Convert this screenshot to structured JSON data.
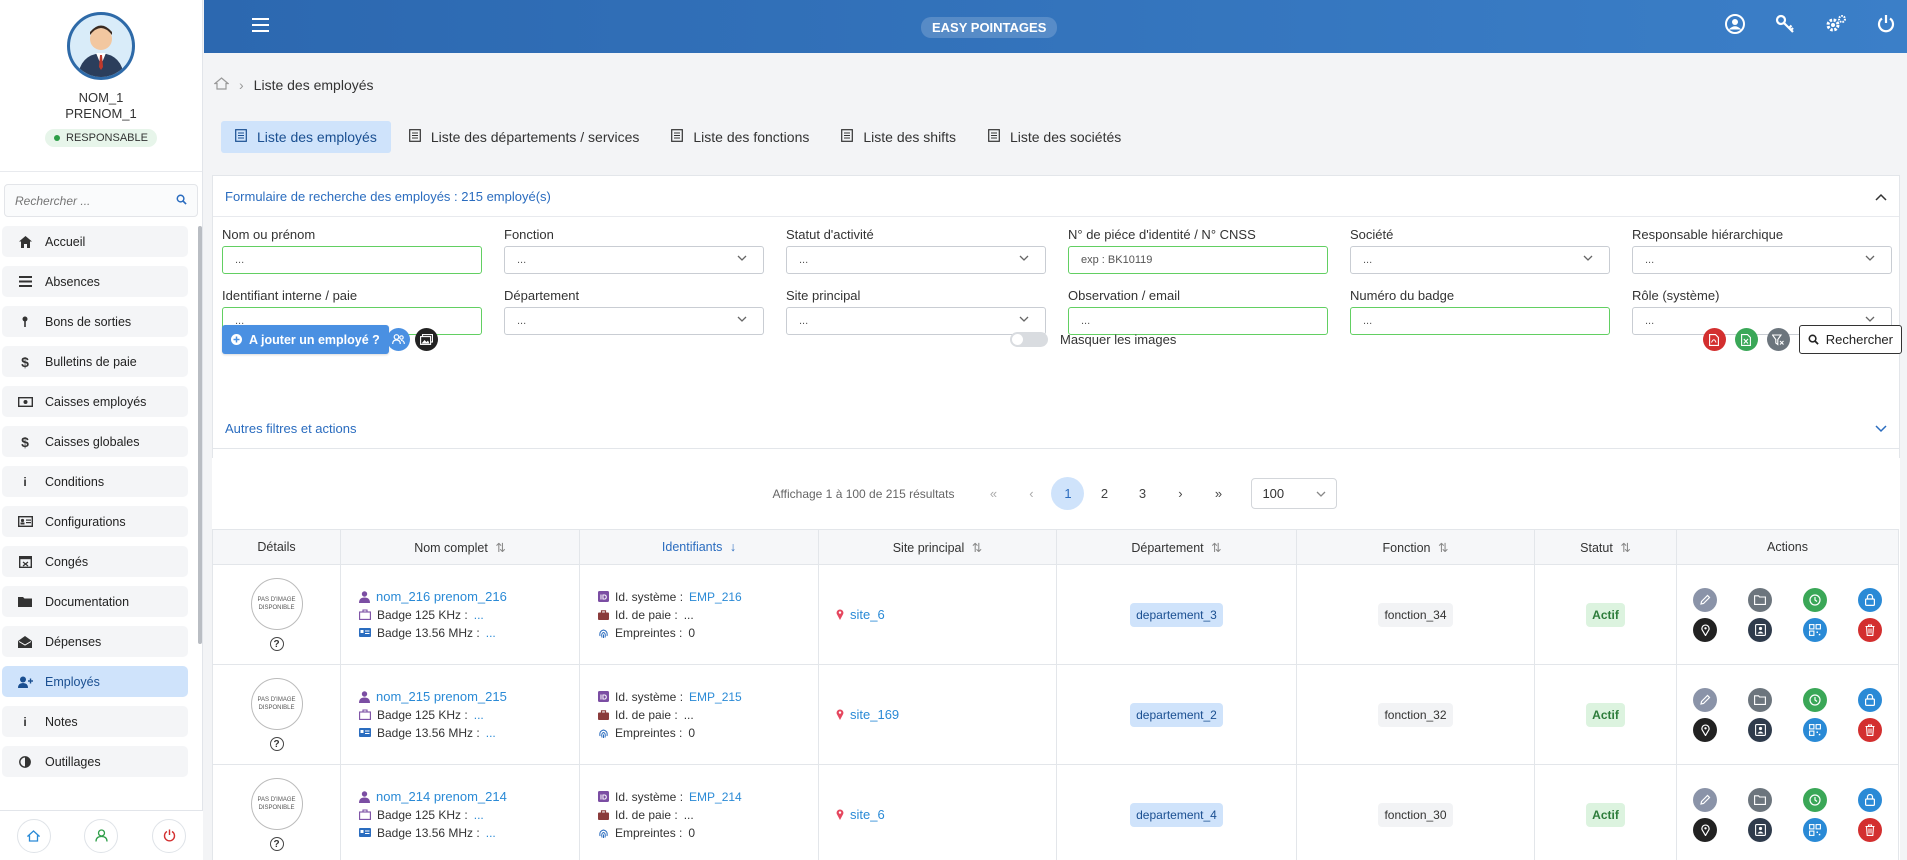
{
  "profile": {
    "last_name": "NOM_1",
    "first_name": "PRENOM_1",
    "role": "RESPONSABLE"
  },
  "sidebar": {
    "search_placeholder": "Rechercher ...",
    "items": [
      {
        "label": "Accueil",
        "icon": "home-icon"
      },
      {
        "label": "Absences",
        "icon": "list-icon"
      },
      {
        "label": "Bons de sorties",
        "icon": "key-icon"
      },
      {
        "label": "Bulletins de paie",
        "icon": "dollar-icon"
      },
      {
        "label": "Caisses employés",
        "icon": "cash-icon"
      },
      {
        "label": "Caisses globales",
        "icon": "dollar-icon"
      },
      {
        "label": "Conditions",
        "icon": "info-icon"
      },
      {
        "label": "Configurations",
        "icon": "id-card-icon"
      },
      {
        "label": "Congés",
        "icon": "calendar-icon"
      },
      {
        "label": "Documentation",
        "icon": "folder-icon"
      },
      {
        "label": "Dépenses",
        "icon": "envelope-icon"
      },
      {
        "label": "Employés",
        "icon": "user-plus-icon",
        "active": true
      },
      {
        "label": "Notes",
        "icon": "info-icon"
      },
      {
        "label": "Outillages",
        "icon": "contrast-icon"
      }
    ]
  },
  "topbar": {
    "brand": "EASY POINTAGES"
  },
  "breadcrumb": {
    "current": "Liste des employés"
  },
  "tabs": [
    {
      "label": "Liste des employés",
      "active": true
    },
    {
      "label": "Liste des départements / services"
    },
    {
      "label": "Liste des fonctions"
    },
    {
      "label": "Liste des shifts"
    },
    {
      "label": "Liste des sociétés"
    }
  ],
  "search_form": {
    "title": "Formulaire de recherche des employés : 215 employé(s)",
    "fields": [
      {
        "label": "Nom ou prénom",
        "value": "...",
        "type": "input"
      },
      {
        "label": "Fonction",
        "value": "...",
        "type": "select"
      },
      {
        "label": "Statut d'activité",
        "value": "...",
        "type": "select"
      },
      {
        "label": "N° de piéce d'identité / N° CNSS",
        "value": "exp : BK10119",
        "type": "input"
      },
      {
        "label": "Société",
        "value": "...",
        "type": "select"
      },
      {
        "label": "Responsable hiérarchique",
        "value": "...",
        "type": "select"
      },
      {
        "label": "Identifiant interne / paie",
        "value": "...",
        "type": "input"
      },
      {
        "label": "Département",
        "value": "...",
        "type": "select"
      },
      {
        "label": "Site principal",
        "value": "...",
        "type": "select"
      },
      {
        "label": "Observation / email",
        "value": "...",
        "type": "input"
      },
      {
        "label": "Numéro du badge",
        "value": "...",
        "type": "input"
      },
      {
        "label": "Rôle (système)",
        "value": "...",
        "type": "select"
      }
    ],
    "add_button": "A jouter un employé ?",
    "hide_images_label": "Masquer les images",
    "search_button": "Rechercher"
  },
  "other_filters": {
    "title": "Autres filtres et actions"
  },
  "pagination": {
    "summary": "Affichage 1 à 100 de 215 résultats",
    "pages": [
      "1",
      "2",
      "3"
    ],
    "current": "1",
    "per_page": "100"
  },
  "table": {
    "columns": [
      "Détails",
      "Nom complet",
      "Identifiants",
      "Site principal",
      "Département",
      "Fonction",
      "Statut",
      "Actions"
    ],
    "no_image_text": "PAS D'IMAGE DISPONIBLE",
    "labels": {
      "badge125": "Badge 125 KHz :",
      "badge1356": "Badge 13.56 MHz :",
      "id_sys": "Id. système :",
      "id_paie": "Id. de paie :",
      "empreintes": "Empreintes :"
    },
    "rows": [
      {
        "name": "nom_216 prenom_216",
        "badge125": "...",
        "badge1356": "...",
        "id_sys": "EMP_216",
        "id_paie": "...",
        "empreintes": "0",
        "site": "site_6",
        "departement": "departement_3",
        "fonction": "fonction_34",
        "statut": "Actif"
      },
      {
        "name": "nom_215 prenom_215",
        "badge125": "...",
        "badge1356": "...",
        "id_sys": "EMP_215",
        "id_paie": "...",
        "empreintes": "0",
        "site": "site_169",
        "departement": "departement_2",
        "fonction": "fonction_32",
        "statut": "Actif"
      },
      {
        "name": "nom_214 prenom_214",
        "badge125": "...",
        "badge1356": "...",
        "id_sys": "EMP_214",
        "id_paie": "...",
        "empreintes": "0",
        "site": "site_6",
        "departement": "departement_4",
        "fonction": "fonction_30",
        "statut": "Actif"
      }
    ]
  },
  "colors": {
    "primary": "#2c68b0",
    "accent": "#4a90e2",
    "active_bg": "#cfe3fb",
    "status_green": "#2d7d3b",
    "danger": "#d32f2f"
  }
}
